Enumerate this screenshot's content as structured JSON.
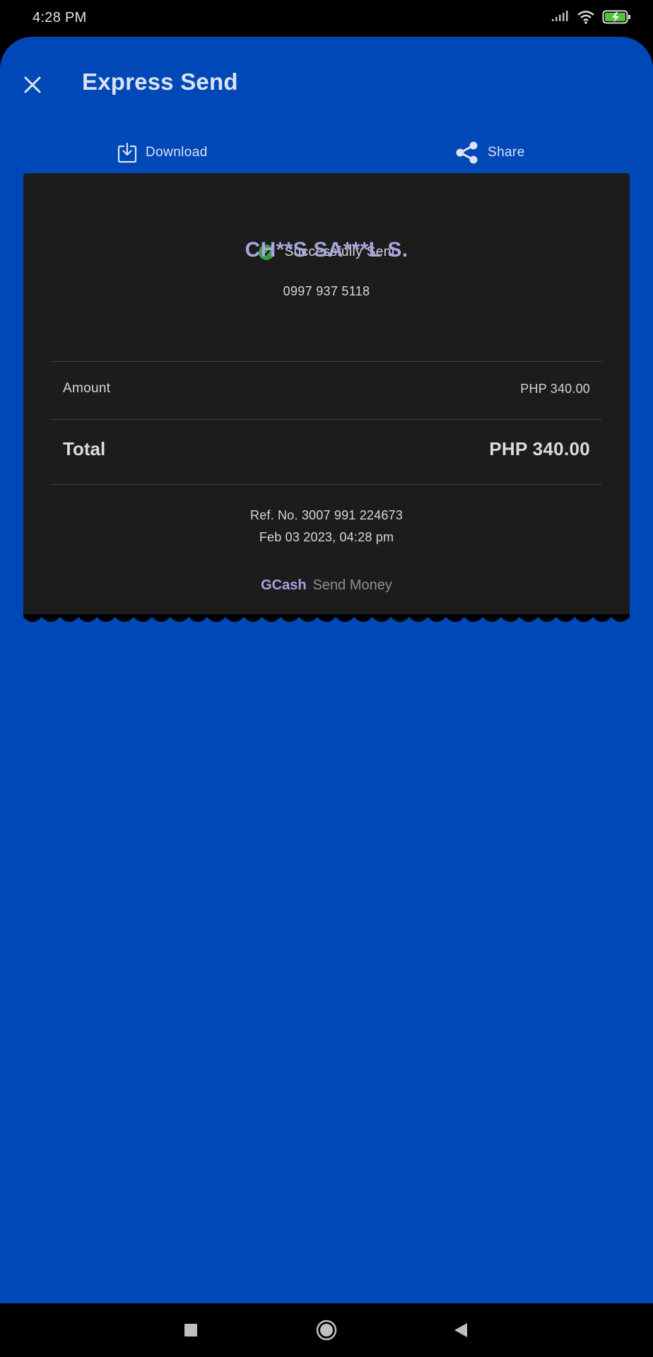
{
  "status_bar": {
    "time": "4:28 PM",
    "icons": [
      "signal-icon",
      "wifi-icon",
      "battery-charging-icon"
    ]
  },
  "header": {
    "title": "Express Send",
    "close_icon": "close-icon"
  },
  "actions": {
    "download_label": "Download",
    "share_label": "Share"
  },
  "receipt": {
    "status": "Successfully Sent",
    "recipient_name": "CH**S SA***L S.",
    "recipient_number": "0997 937 5118",
    "amount_label": "Amount",
    "amount_value": "PHP 340.00",
    "total_label": "Total",
    "total_value": "PHP 340.00",
    "reference": "Ref. No. 3007 991 224673",
    "datetime": "Feb 03 2023, 04:28 pm",
    "brand": "GCash",
    "service": "Send Money"
  },
  "colors": {
    "background": "#0048b8",
    "receipt": "#1c1c1c",
    "success": "#3a9a47",
    "accent": "#a8a4dc"
  }
}
